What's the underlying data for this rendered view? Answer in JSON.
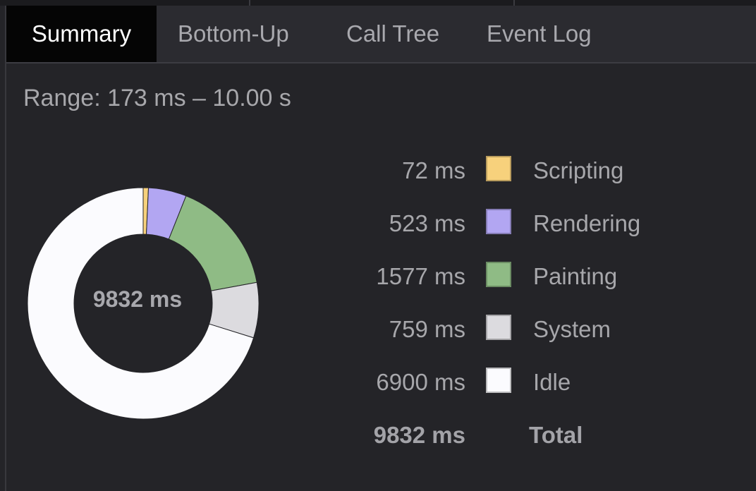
{
  "tabs": [
    {
      "label": "Summary",
      "active": true
    },
    {
      "label": "Bottom-Up",
      "active": false
    },
    {
      "label": "Call Tree",
      "active": false
    },
    {
      "label": "Event Log",
      "active": false
    }
  ],
  "range": {
    "label": "Range: 173 ms – 10.00 s"
  },
  "summary": {
    "total_label": "9832 ms",
    "categories": [
      {
        "name": "Scripting",
        "value_label": "72 ms",
        "value": 72,
        "color": "#f7d17c"
      },
      {
        "name": "Rendering",
        "value_label": "523 ms",
        "value": 523,
        "color": "#b2a6f2"
      },
      {
        "name": "Painting",
        "value_label": "1577 ms",
        "value": 1577,
        "color": "#8fbb85"
      },
      {
        "name": "System",
        "value_label": "759 ms",
        "value": 759,
        "color": "#dcdbdf"
      },
      {
        "name": "Idle",
        "value_label": "6900 ms",
        "value": 6900,
        "color": "#fbfbfe"
      }
    ],
    "total": {
      "name": "Total",
      "value_label": "9832 ms"
    }
  }
}
